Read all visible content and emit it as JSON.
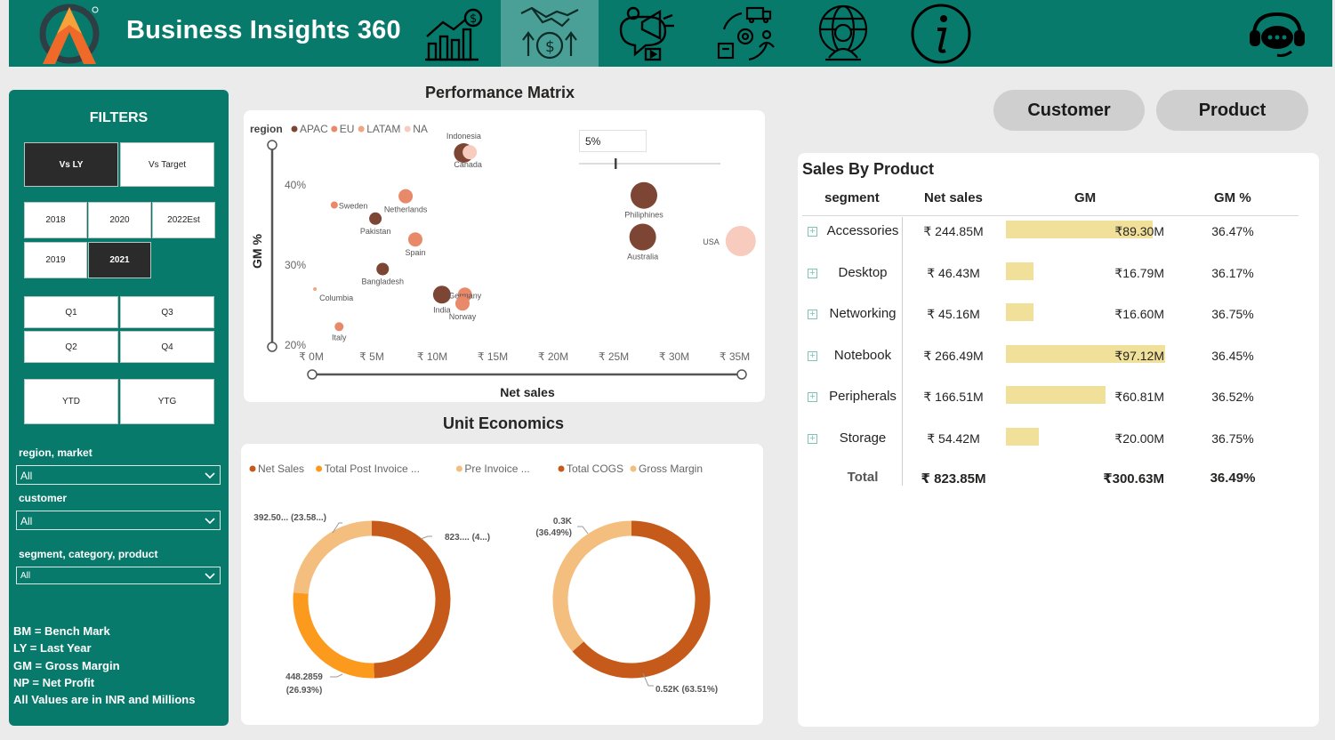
{
  "app": {
    "title": "Business Insights 360"
  },
  "nav": [
    {
      "name": "finance-view-icon"
    },
    {
      "name": "profit-loss-handshake-icon",
      "active": true
    },
    {
      "name": "marketing-megaphone-icon"
    },
    {
      "name": "supply-chain-icon"
    },
    {
      "name": "executive-globe-icon"
    },
    {
      "name": "info-icon"
    }
  ],
  "filters": {
    "title": "FILTERS",
    "compare": [
      "Vs LY",
      "Vs Target"
    ],
    "years": [
      "2018",
      "2020",
      "2022Est",
      "2019",
      "2021"
    ],
    "selected_year": "2021",
    "quarters": [
      "Q1",
      "Q3",
      "Q2",
      "Q4"
    ],
    "periods": [
      "YTD",
      "YTG"
    ],
    "slicers": [
      {
        "label": "region, market",
        "value": "All"
      },
      {
        "label": "customer",
        "value": "All"
      },
      {
        "label": "segment, category, product",
        "value": "All"
      }
    ],
    "notes": [
      "BM = Bench Mark",
      "LY = Last Year",
      "GM = Gross Margin",
      "NP = Net Profit",
      "All Values are in INR and Millions"
    ]
  },
  "performance_matrix": {
    "title": "Performance Matrix",
    "slider_value": "5%"
  },
  "unit_economics": {
    "title": "Unit Economics"
  },
  "toggles": {
    "customer": "Customer",
    "product": "Product"
  },
  "sales_by_product": {
    "title": "Sales By Product",
    "headers": {
      "segment": "segment",
      "net_sales": "Net sales",
      "gm": "GM",
      "gm_pct": "GM %"
    },
    "rows": [
      {
        "segment": "Accessories",
        "net_sales": "₹ 244.85M",
        "gm": "₹89.30M",
        "gm_pct": "36.47%",
        "gm_value": 89.3
      },
      {
        "segment": "Desktop",
        "net_sales": "₹ 46.43M",
        "gm": "₹16.79M",
        "gm_pct": "36.17%",
        "gm_value": 16.79
      },
      {
        "segment": "Networking",
        "net_sales": "₹ 45.16M",
        "gm": "₹16.60M",
        "gm_pct": "36.75%",
        "gm_value": 16.6
      },
      {
        "segment": "Notebook",
        "net_sales": "₹ 266.49M",
        "gm": "₹97.12M",
        "gm_pct": "36.45%",
        "gm_value": 97.12
      },
      {
        "segment": "Peripherals",
        "net_sales": "₹ 166.51M",
        "gm": "₹60.81M",
        "gm_pct": "36.52%",
        "gm_value": 60.81
      },
      {
        "segment": "Storage",
        "net_sales": "₹ 54.42M",
        "gm": "₹20.00M",
        "gm_pct": "36.75%",
        "gm_value": 20.0
      }
    ],
    "total": {
      "label": "Total",
      "net_sales": "₹ 823.85M",
      "gm": "₹300.63M",
      "gm_pct": "36.49%"
    }
  },
  "chart_data": [
    {
      "type": "scatter",
      "title": "Performance Matrix",
      "xlabel": "Net sales",
      "ylabel": "GM %",
      "legend_title": "region",
      "legend_position": "top-left",
      "x_ticks": [
        "₹ 0M",
        "₹ 5M",
        "₹ 10M",
        "₹ 15M",
        "₹ 20M",
        "₹ 25M",
        "₹ 30M",
        "₹ 35M"
      ],
      "y_ticks": [
        "20%",
        "30%",
        "40%"
      ],
      "xlim": [
        0,
        35
      ],
      "ylim": [
        20,
        41.5
      ],
      "series": [
        {
          "name": "APAC",
          "color": "#7d4533",
          "points": [
            {
              "label": "Indonesia",
              "x": 12.6,
              "y": 44.0,
              "size": 11
            },
            {
              "label": "Philiphines",
              "x": 27.5,
              "y": 38.7,
              "size": 15
            },
            {
              "label": "Australia",
              "x": 27.4,
              "y": 33.5,
              "size": 15
            },
            {
              "label": "Pakistan",
              "x": 5.3,
              "y": 35.8,
              "size": 7
            },
            {
              "label": "Bangladesh",
              "x": 5.9,
              "y": 29.5,
              "size": 7
            },
            {
              "label": "India",
              "x": 10.8,
              "y": 26.3,
              "size": 10
            }
          ]
        },
        {
          "name": "EU",
          "color": "#e8896a",
          "points": [
            {
              "label": "Sweden",
              "x": 1.9,
              "y": 37.5,
              "size": 4
            },
            {
              "label": "Netherlands",
              "x": 7.8,
              "y": 38.6,
              "size": 8
            },
            {
              "label": "Spain",
              "x": 8.6,
              "y": 33.2,
              "size": 8
            },
            {
              "label": "Germany",
              "x": 12.7,
              "y": 26.3,
              "size": 8
            },
            {
              "label": "Norway",
              "x": 12.5,
              "y": 25.2,
              "size": 8
            },
            {
              "label": "Italy",
              "x": 2.3,
              "y": 22.3,
              "size": 5
            }
          ]
        },
        {
          "name": "LATAM",
          "color": "#f2a57e",
          "points": [
            {
              "label": "Columbia",
              "x": 0.3,
              "y": 27.0,
              "size": 2
            }
          ]
        },
        {
          "name": "NA",
          "color": "#f7ccbe",
          "points": [
            {
              "label": "Canada",
              "x": 13.1,
              "y": 44.1,
              "size": 8
            },
            {
              "label": "USA",
              "x": 35.5,
              "y": 33.0,
              "size": 17
            }
          ]
        }
      ]
    },
    {
      "type": "pie",
      "variant": "donut",
      "legend_position": "top-left",
      "legend": [
        "Net Sales",
        "Total Post Invoice ...",
        "Pre Invoice ..."
      ],
      "slices": [
        {
          "name": "Net Sales",
          "value": 823.85,
          "label": "823.... (4...)",
          "color": "#c55a1a"
        },
        {
          "name": "Total Post Invoice ...",
          "value": 448.2859,
          "label": "448.2859 (26.93%)",
          "color": "#fb9a1c"
        },
        {
          "name": "Pre Invoice ...",
          "value": 392.5,
          "label": "392.50... (23.58...)",
          "color": "#f4be7f"
        }
      ]
    },
    {
      "type": "pie",
      "variant": "donut",
      "legend_position": "top-left",
      "legend": [
        "Total COGS",
        "Gross Margin"
      ],
      "slices": [
        {
          "name": "Total COGS",
          "value": 63.51,
          "label": "0.52K (63.51%)",
          "color": "#c55a1a"
        },
        {
          "name": "Gross Margin",
          "value": 36.49,
          "label": "0.3K (36.49%)",
          "color": "#f4be7f"
        }
      ]
    }
  ]
}
